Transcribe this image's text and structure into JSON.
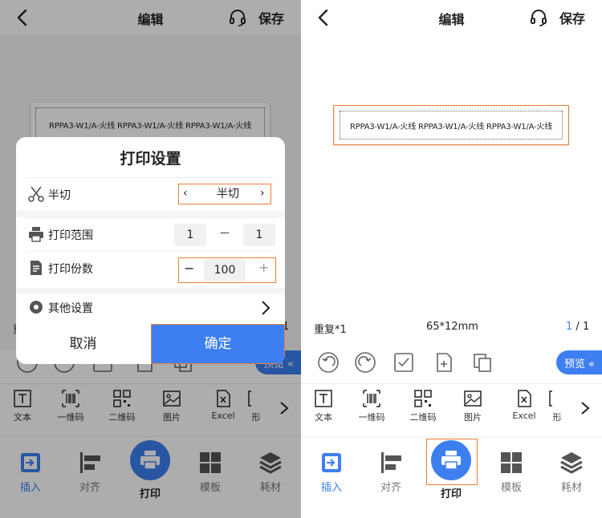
{
  "header": {
    "title": "编辑",
    "save_label": "保存"
  },
  "label": {
    "text": "RPPA3-W1/A-火线  RPPA3-W1/A-火线  RPPA3-W1/A-火线"
  },
  "info": {
    "repeat": "重复*1",
    "size": "65*12mm",
    "page_current": "1",
    "page_sep": "/",
    "page_total": "1",
    "left_partial": "重",
    "right_partial": "1"
  },
  "preview_label": "预览",
  "insert_items": [
    {
      "label": "文本",
      "icon": "text-icon"
    },
    {
      "label": "一维码",
      "icon": "barcode-icon"
    },
    {
      "label": "二维码",
      "icon": "qrcode-icon"
    },
    {
      "label": "图片",
      "icon": "image-icon"
    },
    {
      "label": "Excel",
      "icon": "excel-icon"
    },
    {
      "label": "形",
      "icon": "shape-icon"
    }
  ],
  "nav": [
    {
      "label": "插入",
      "icon": "insert-icon",
      "active": true
    },
    {
      "label": "对齐",
      "icon": "align-icon"
    },
    {
      "label": "打印",
      "icon": "printer-icon"
    },
    {
      "label": "模板",
      "icon": "template-icon"
    },
    {
      "label": "耗材",
      "icon": "consumables-icon"
    }
  ],
  "dialog": {
    "title": "打印设置",
    "cut": {
      "label": "半切",
      "value": "半切"
    },
    "range": {
      "label": "打印范围",
      "from": "1",
      "dash": "—",
      "to": "1"
    },
    "copies": {
      "label": "打印份数",
      "minus": "−",
      "value": "100",
      "plus": "+"
    },
    "other": {
      "label": "其他设置"
    },
    "cancel": "取消",
    "confirm": "确定"
  },
  "colors": {
    "accent": "#3d7ff0",
    "highlight": "#ee7d33"
  }
}
